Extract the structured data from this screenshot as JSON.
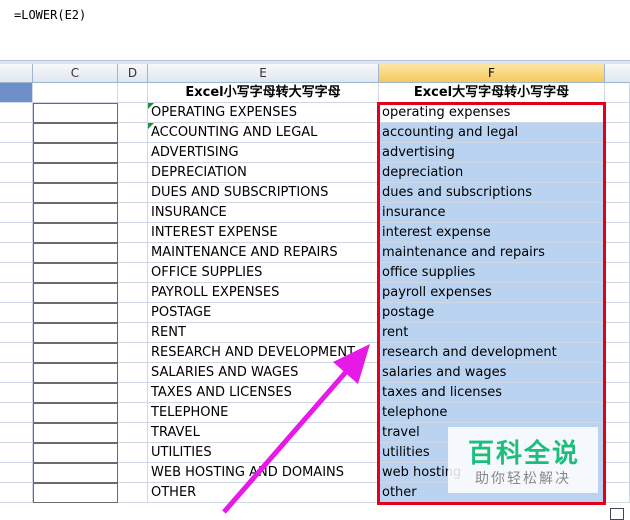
{
  "formula": "=LOWER(E2)",
  "columns": {
    "c": "C",
    "d": "D",
    "e": "E",
    "f": "F"
  },
  "headers": {
    "e": "Excel小写字母转大写字母",
    "f": "Excel大写字母转小写字母"
  },
  "rows": [
    {
      "upper": "OPERATING EXPENSES",
      "lower": "operating expenses"
    },
    {
      "upper": "ACCOUNTING AND LEGAL",
      "lower": "accounting and legal"
    },
    {
      "upper": "ADVERTISING",
      "lower": "advertising"
    },
    {
      "upper": "DEPRECIATION",
      "lower": "depreciation"
    },
    {
      "upper": "DUES AND SUBSCRIPTIONS",
      "lower": "dues and subscriptions"
    },
    {
      "upper": "INSURANCE",
      "lower": "insurance"
    },
    {
      "upper": "INTEREST EXPENSE",
      "lower": "interest expense"
    },
    {
      "upper": "MAINTENANCE AND REPAIRS",
      "lower": "maintenance and repairs"
    },
    {
      "upper": "OFFICE SUPPLIES",
      "lower": "office supplies"
    },
    {
      "upper": "PAYROLL EXPENSES",
      "lower": "payroll expenses"
    },
    {
      "upper": "POSTAGE",
      "lower": "postage"
    },
    {
      "upper": "RENT",
      "lower": "rent"
    },
    {
      "upper": "RESEARCH AND DEVELOPMENT",
      "lower": "research and development"
    },
    {
      "upper": "SALARIES AND WAGES",
      "lower": "salaries and wages"
    },
    {
      "upper": "TAXES AND LICENSES",
      "lower": "taxes and licenses"
    },
    {
      "upper": "TELEPHONE",
      "lower": "telephone"
    },
    {
      "upper": "TRAVEL",
      "lower": "travel"
    },
    {
      "upper": "UTILITIES",
      "lower": "utilities"
    },
    {
      "upper": "WEB HOSTING AND DOMAINS",
      "lower": "web hosting"
    },
    {
      "upper": "OTHER",
      "lower": "other"
    }
  ],
  "watermark": {
    "title": "百科全说",
    "subtitle": "助你轻松解决"
  },
  "colors": {
    "selection_border": "#e0001b",
    "selection_fill": "#b9d3f1",
    "arrow": "#e619e6",
    "watermark": "#1bbf7b"
  }
}
